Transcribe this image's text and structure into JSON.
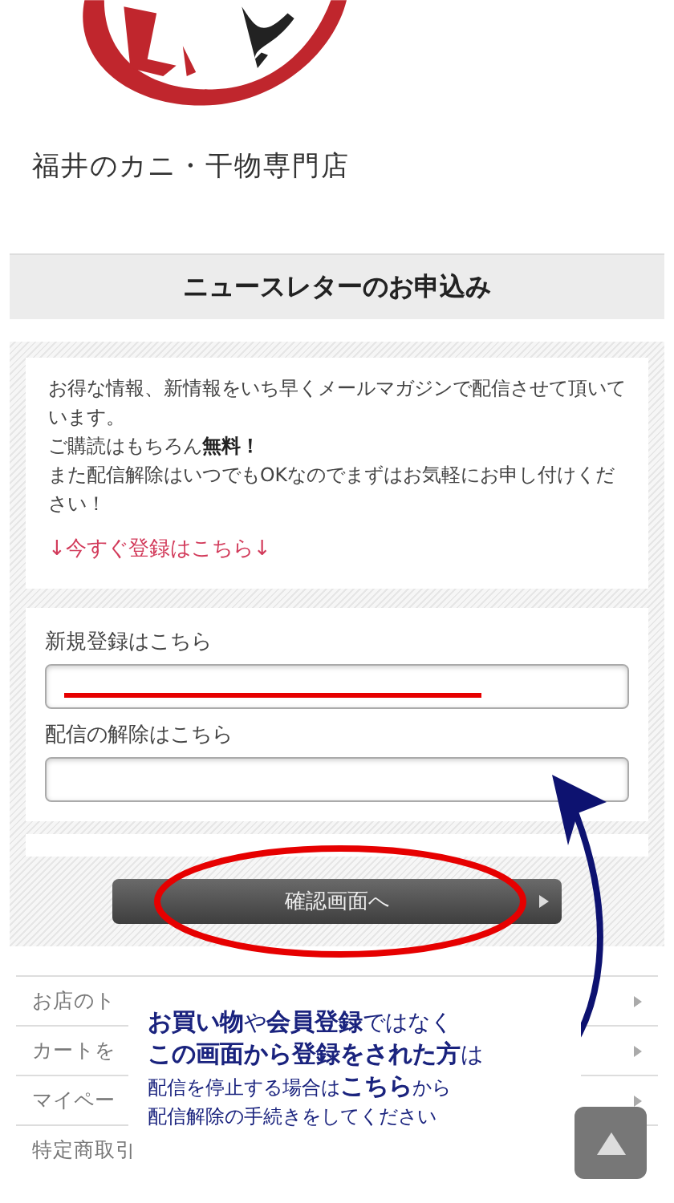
{
  "header": {
    "tagline": "福井のカニ・干物専門店"
  },
  "page_title": "ニュースレターのお申込み",
  "intro": {
    "paragraphs": [
      "お得な情報、新情報をいち早くメールマガジンで配信させて頂いています。",
      "ご購読はもちろん**無料！**",
      "また配信解除はいつでもOKなのでまずはお気軽にお申し付けください！"
    ],
    "link": "↓今すぐ登録はこちら↓"
  },
  "form": {
    "fields": [
      {
        "label": "新規登録はこちら",
        "highlighted": true
      },
      {
        "label": "配信の解除はこちら",
        "highlighted": false
      }
    ]
  },
  "confirm_button": {
    "label": "確認画面へ",
    "circled": true
  },
  "menu": [
    {
      "label": "お店のト"
    },
    {
      "label": "カートを"
    },
    {
      "label": "マイペー"
    },
    {
      "label": "特定商取引"
    }
  ],
  "annotation": {
    "lines": [
      "**お買い物**や**会員登録**ではなく",
      "**この画面から登録をされた方**は",
      "配信を停止する場合は**こちら**から",
      "配信解除の手続きをしてください"
    ]
  }
}
